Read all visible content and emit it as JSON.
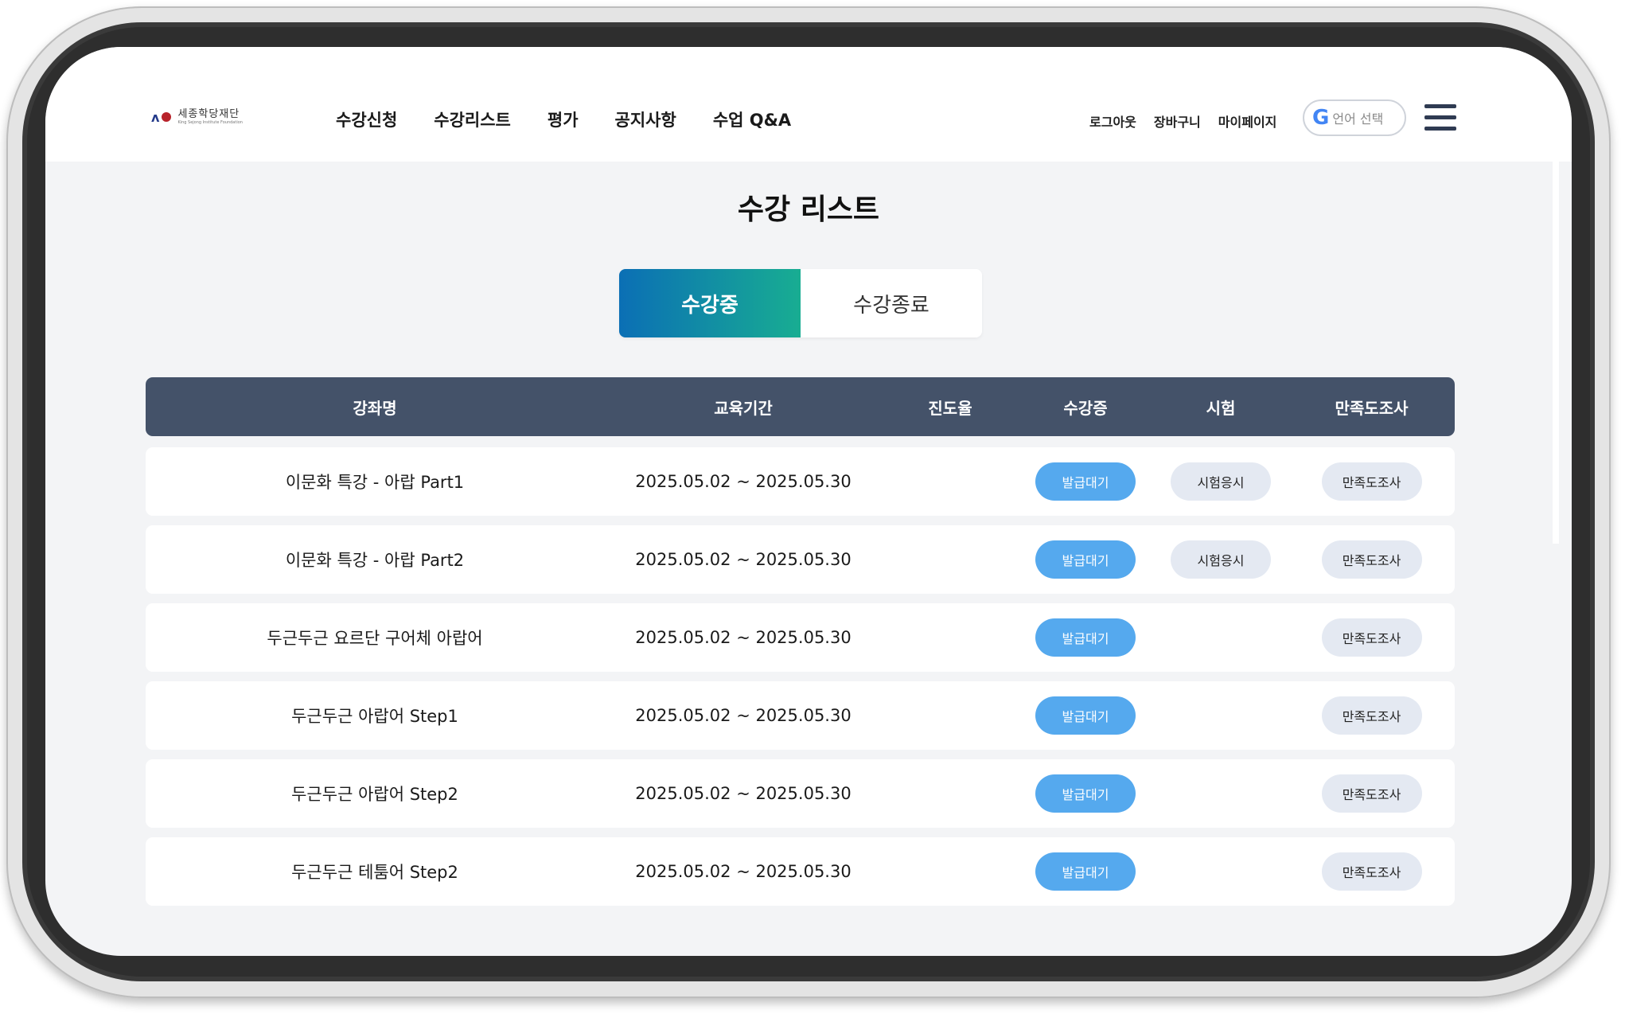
{
  "header": {
    "logo": {
      "name": "세종학당재단",
      "sub": "King Sejong Institute Foundation"
    },
    "nav": [
      "수강신청",
      "수강리스트",
      "평가",
      "공지사항",
      "수업 Q&A"
    ],
    "util": [
      "로그아웃",
      "장바구니",
      "마이페이지"
    ],
    "lang_button": {
      "icon": "G",
      "label": "언어 선택"
    }
  },
  "main": {
    "title": "수강 리스트",
    "tabs": [
      {
        "label": "수강중",
        "active": true
      },
      {
        "label": "수강종료",
        "active": false
      }
    ],
    "table": {
      "headers": [
        "강좌명",
        "교육기간",
        "진도율",
        "수강증",
        "시험",
        "만족도조사"
      ],
      "rows": [
        {
          "name": "이문화 특강 - 아랍 Part1",
          "period": "2025.05.02 ~ 2025.05.30",
          "cert": "발급대기",
          "exam": "시험응시",
          "survey": "만족도조사"
        },
        {
          "name": "이문화 특강 - 아랍 Part2",
          "period": "2025.05.02 ~ 2025.05.30",
          "cert": "발급대기",
          "exam": "시험응시",
          "survey": "만족도조사"
        },
        {
          "name": "두근두근 요르단 구어체 아랍어",
          "period": "2025.05.02 ~ 2025.05.30",
          "cert": "발급대기",
          "exam": "",
          "survey": "만족도조사"
        },
        {
          "name": "두근두근 아랍어 Step1",
          "period": "2025.05.02 ~ 2025.05.30",
          "cert": "발급대기",
          "exam": "",
          "survey": "만족도조사"
        },
        {
          "name": "두근두근 아랍어 Step2",
          "period": "2025.05.02 ~ 2025.05.30",
          "cert": "발급대기",
          "exam": "",
          "survey": "만족도조사"
        },
        {
          "name": "두근두근 테툼어 Step2",
          "period": "2025.05.02 ~ 2025.05.30",
          "cert": "발급대기",
          "exam": "",
          "survey": "만족도조사"
        }
      ]
    }
  },
  "colors": {
    "accent_start": "#0b6fb5",
    "accent_end": "#18ad92",
    "table_header": "#445269",
    "cert_button": "#55a9ee",
    "grey_button": "#e4e9f2"
  },
  "icons": [
    "google-icon",
    "hamburger-menu-icon"
  ]
}
